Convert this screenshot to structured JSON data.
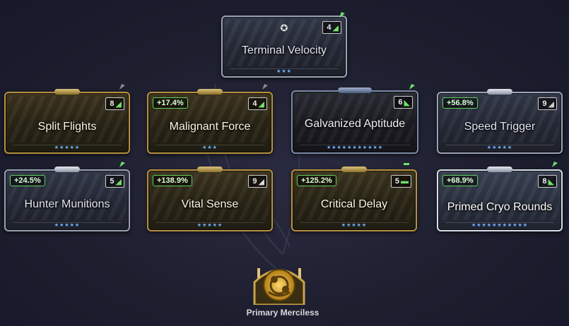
{
  "mods": [
    {
      "id": "terminal-velocity",
      "name": "Terminal Velocity",
      "bonus": "",
      "rank": "4",
      "polarity": "madurai",
      "tier": "silver",
      "stars": "★★★"
    },
    {
      "id": "split-flights",
      "name": "Split Flights",
      "bonus": "",
      "rank": "8",
      "polarity": "madurai",
      "tier": "gold",
      "stars": "★★★★★"
    },
    {
      "id": "malignant-force",
      "name": "Malignant Force",
      "bonus": "+17.4%",
      "rank": "4",
      "polarity": "madurai",
      "tier": "gold",
      "stars": "★★★"
    },
    {
      "id": "galvanized-aptitude",
      "name": "Galvanized Aptitude",
      "bonus": "",
      "rank": "6",
      "polarity": "vazarin",
      "tier": "dark",
      "stars": "★★★★★★★★★★★"
    },
    {
      "id": "speed-trigger",
      "name": "Speed Trigger",
      "bonus": "+56.8%",
      "rank": "9",
      "polarity": "madurai",
      "tier": "silver",
      "stars": "★★★★★"
    },
    {
      "id": "hunter-munitions",
      "name": "Hunter Munitions",
      "bonus": "+24.5%",
      "rank": "5",
      "polarity": "madurai",
      "tier": "silver",
      "stars": "★★★★★"
    },
    {
      "id": "vital-sense",
      "name": "Vital Sense",
      "bonus": "+138.9%",
      "rank": "9",
      "polarity": "madurai",
      "tier": "gold",
      "stars": "★★★★★"
    },
    {
      "id": "critical-delay",
      "name": "Critical Delay",
      "bonus": "+125.2%",
      "rank": "5",
      "polarity": "naramon",
      "tier": "gold",
      "stars": "★★★★★"
    },
    {
      "id": "primed-cryo-rounds",
      "name": "Primed Cryo Rounds",
      "bonus": "+68.9%",
      "rank": "8",
      "polarity": "vazarin",
      "tier": "primed",
      "stars": "★★★★★★★★★★★"
    }
  ],
  "emblem": {
    "label": "Primary Merciless",
    "icon": "arcane-emblem-icon"
  },
  "colors": {
    "polarity_green": "#6fe06a",
    "bonus_border": "#5fd05b",
    "gold": "#b8913e",
    "silver": "#9aa3b3"
  }
}
